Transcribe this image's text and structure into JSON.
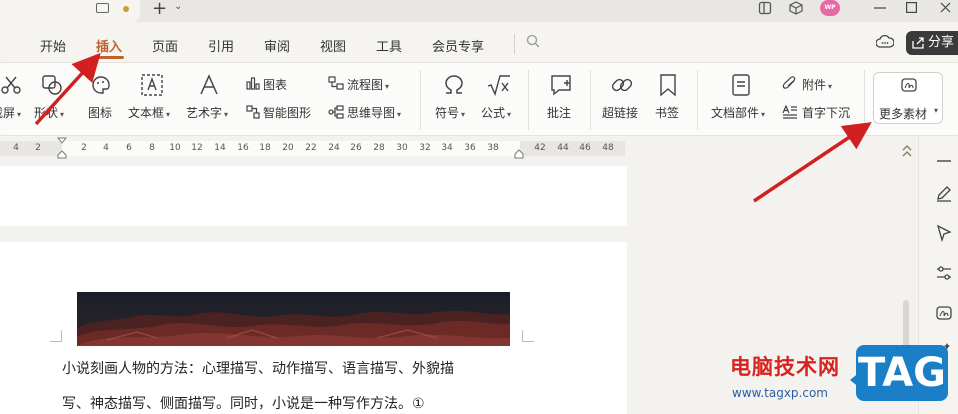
{
  "titlebar": {
    "tabs_dropdown": "⌄",
    "new_tab": "+"
  },
  "user": {
    "avatar_text": "WP"
  },
  "ribbon_tabs": [
    {
      "label": "开始"
    },
    {
      "label": "插入"
    },
    {
      "label": "页面"
    },
    {
      "label": "引用"
    },
    {
      "label": "审阅"
    },
    {
      "label": "视图"
    },
    {
      "label": "工具"
    },
    {
      "label": "会员专享"
    }
  ],
  "share_label": "分享",
  "toolbar": {
    "screenshot": "截屏",
    "shape": "形状",
    "icon": "图标",
    "textbox": "文本框",
    "wordart": "艺术字",
    "chart": "图表",
    "smartart": "智能图形",
    "flowchart": "流程图",
    "mindmap": "思维导图",
    "symbol": "符号",
    "formula": "公式",
    "comment": "批注",
    "hyperlink": "超链接",
    "bookmark": "书签",
    "docpart": "文档部件",
    "attachment": "附件",
    "dropcap": "首字下沉",
    "more_material": "更多素材"
  },
  "ruler": {
    "ticks": [
      "4",
      "2",
      "2",
      "4",
      "6",
      "8",
      "10",
      "12",
      "14",
      "16",
      "18",
      "20",
      "22",
      "24",
      "26",
      "28",
      "30",
      "32",
      "34",
      "36",
      "38",
      "42",
      "44",
      "46",
      "48"
    ]
  },
  "document": {
    "line1": "小说刻画人物的方法：心理描写、动作描写、语言描写、外貌描",
    "line2": "写、神态描写、侧面描写。同时，小说是一种写作方法。①"
  },
  "watermark": {
    "site_name": "电脑技术网",
    "url": "www.tagxp.com",
    "tag": "TAG"
  },
  "colors": {
    "accent": "#c1622c",
    "arrow": "#d22020",
    "tag_blue": "#1a7fc6"
  }
}
